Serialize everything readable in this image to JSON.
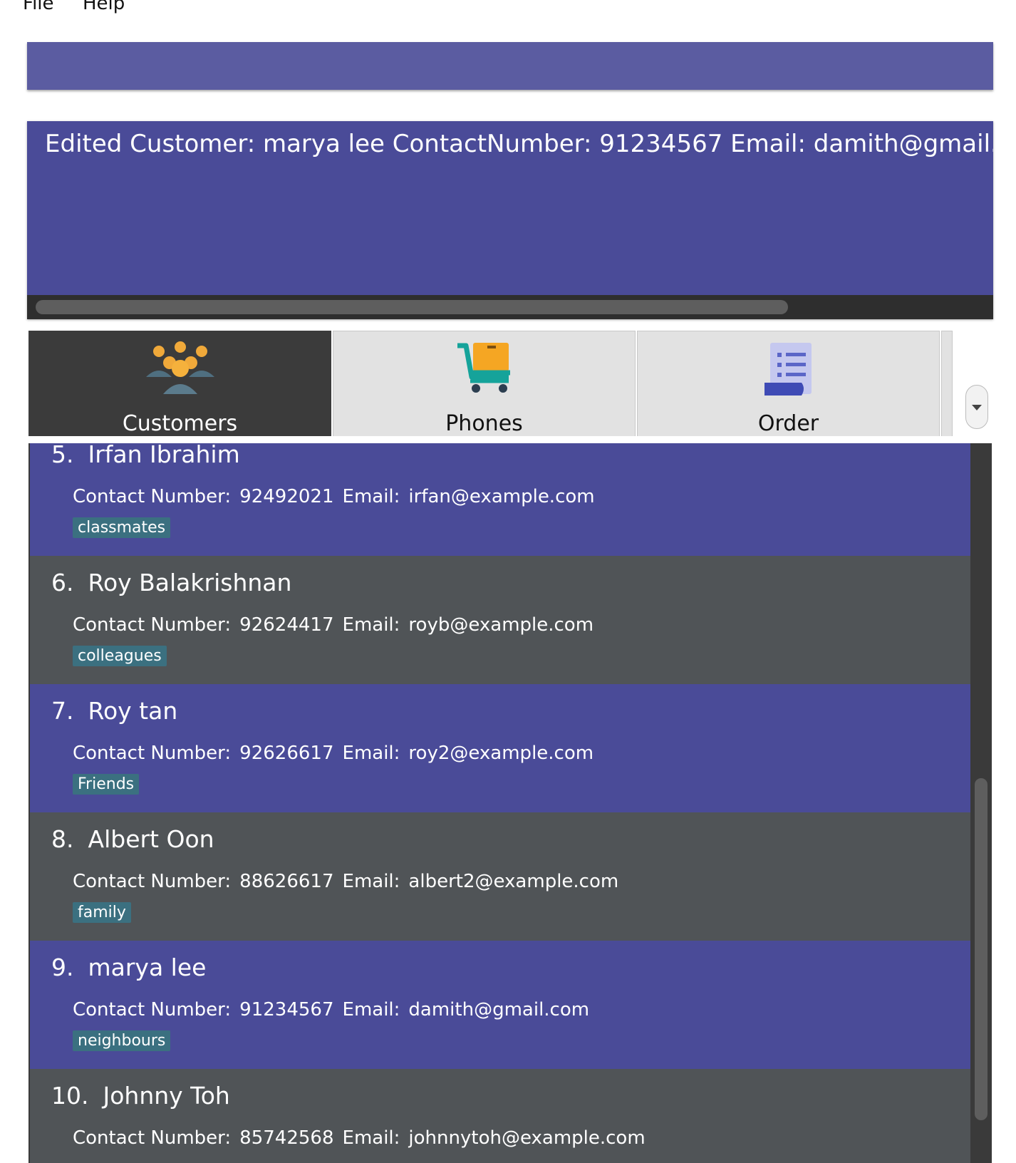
{
  "menu": {
    "file": "File",
    "help": "Help"
  },
  "command": {
    "value": ""
  },
  "result": {
    "text": "Edited Customer: marya lee ContactNumber: 91234567 Email: damith@gmail.com Tags: [neighbours]"
  },
  "tabs": [
    {
      "label": "Customers",
      "icon": "customers-icon"
    },
    {
      "label": "Phones",
      "icon": "shopping-cart-icon"
    },
    {
      "label": "Order",
      "icon": "order-document-icon"
    }
  ],
  "colors": {
    "accent": "#4a4b98",
    "row_alt": "#505457",
    "tag": "#3b7080",
    "command_bg": "#5b5ca1"
  },
  "customers": [
    {
      "index": "5.",
      "name": "Irfan Ibrahim",
      "contact_label": "Contact Number:",
      "contact": "92492021",
      "email_label": "Email:",
      "email": "irfan@example.com",
      "tag": "classmates"
    },
    {
      "index": "6.",
      "name": "Roy Balakrishnan",
      "contact_label": "Contact Number:",
      "contact": "92624417",
      "email_label": "Email:",
      "email": "royb@example.com",
      "tag": "colleagues"
    },
    {
      "index": "7.",
      "name": "Roy tan",
      "contact_label": "Contact Number:",
      "contact": "92626617",
      "email_label": "Email:",
      "email": "roy2@example.com",
      "tag": "Friends"
    },
    {
      "index": "8.",
      "name": "Albert Oon",
      "contact_label": "Contact Number:",
      "contact": "88626617",
      "email_label": "Email:",
      "email": "albert2@example.com",
      "tag": "family"
    },
    {
      "index": "9.",
      "name": "marya lee",
      "contact_label": "Contact Number:",
      "contact": "91234567",
      "email_label": "Email:",
      "email": "damith@gmail.com",
      "tag": "neighbours"
    },
    {
      "index": "10.",
      "name": "Johnny Toh",
      "contact_label": "Contact Number:",
      "contact": "85742568",
      "email_label": "Email:",
      "email": "johnnytoh@example.com",
      "tag": ""
    }
  ]
}
